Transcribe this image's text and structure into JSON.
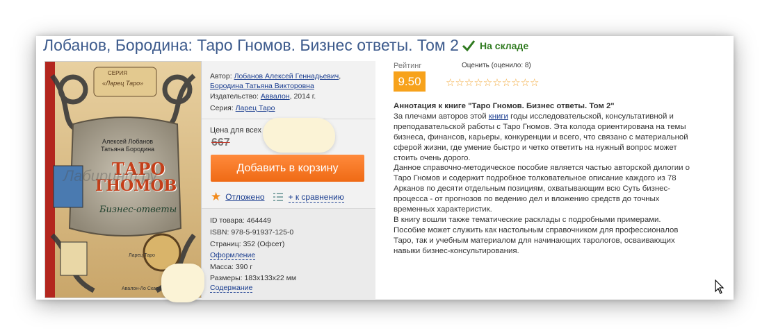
{
  "product": {
    "title": "Лобанов, Бородина: Таро Гномов. Бизнес ответы. Том 2",
    "stock_status": "На складе"
  },
  "cover": {
    "series_label": "СЕРИЯ",
    "series_name": "«Ларец Таро»",
    "authors": "Алексей Лобанов\nТатьяна Бородина",
    "title_line1": "ТАРО",
    "title_line2": "ГНОМОВ",
    "subtitle": "Бизнес-ответы",
    "watermark": "Лабиринт.ру",
    "publisher_logo": "Ларец Таро",
    "bottom_text": "Авалон-Ло Скарабео"
  },
  "details": {
    "author_label": "Автор:",
    "author1": "Лобанов Алексей Геннадьевич",
    "author2": "Бородина Татьяна Викторовна",
    "publisher_label": "Издательство:",
    "publisher": "Аввалон",
    "year": ", 2014 г.",
    "series_label": "Серия:",
    "series": "Ларец Таро"
  },
  "price": {
    "label": "Цена для всех",
    "old_price": "667"
  },
  "actions": {
    "add_to_cart": "Добавить в корзину",
    "postponed": "Отложено",
    "compare": "+ к сравнению"
  },
  "specs": {
    "id": "ID товара: 464449",
    "isbn": "ISBN: 978-5-91937-125-0",
    "pages": "Страниц: 352 (Офсет)",
    "design": "Оформление",
    "mass": "Масса: 390 г",
    "size": "Размеры: 183x133x22 мм",
    "contents": "Содержание"
  },
  "rating": {
    "label": "Рейтинг",
    "value": "9.50",
    "rate_label": "Оценить (оценило: 8)",
    "stars": "☆☆☆☆☆☆☆☆☆☆"
  },
  "annotation": {
    "heading": "Аннотация к книге \"Таро Гномов. Бизнес ответы. Том 2\"",
    "p1_before": "За плечами авторов этой ",
    "p1_link": "книги",
    "p1_after": " годы исследовательской, консультативной и преподавательской работы с Таро Гномов. Эта колода ориентирована на темы бизнеса, финансов, карьеры, конкуренции и всего, что связано с материальной сферой жизни, где умение быстро и четко ответить на нужный вопрос может стоить очень дорого.",
    "p2": "Данное справочно-методическое пособие является частью авторской дилогии о Таро Гномов и содержит подробное толковательное описание каждого из 78 Арканов по десяти отдельным позициям, охватывающим всю Суть бизнес-процесса - от прогнозов по ведению дел и вложению средств до точных временных характеристик.",
    "p3": "В книгу вошли также тематические расклады с подробными примерами. Пособие может служить как настольным справочником для профессионалов Таро, так и учебным материалом для начинающих тарологов, осваивающих навыки бизнес-консультирования."
  },
  "colors": {
    "title": "#3c5a8c",
    "stock": "#2f7a1f",
    "cart_button": "#f6792a",
    "rating_box": "#f7a21b",
    "link": "#1a3d8f"
  }
}
